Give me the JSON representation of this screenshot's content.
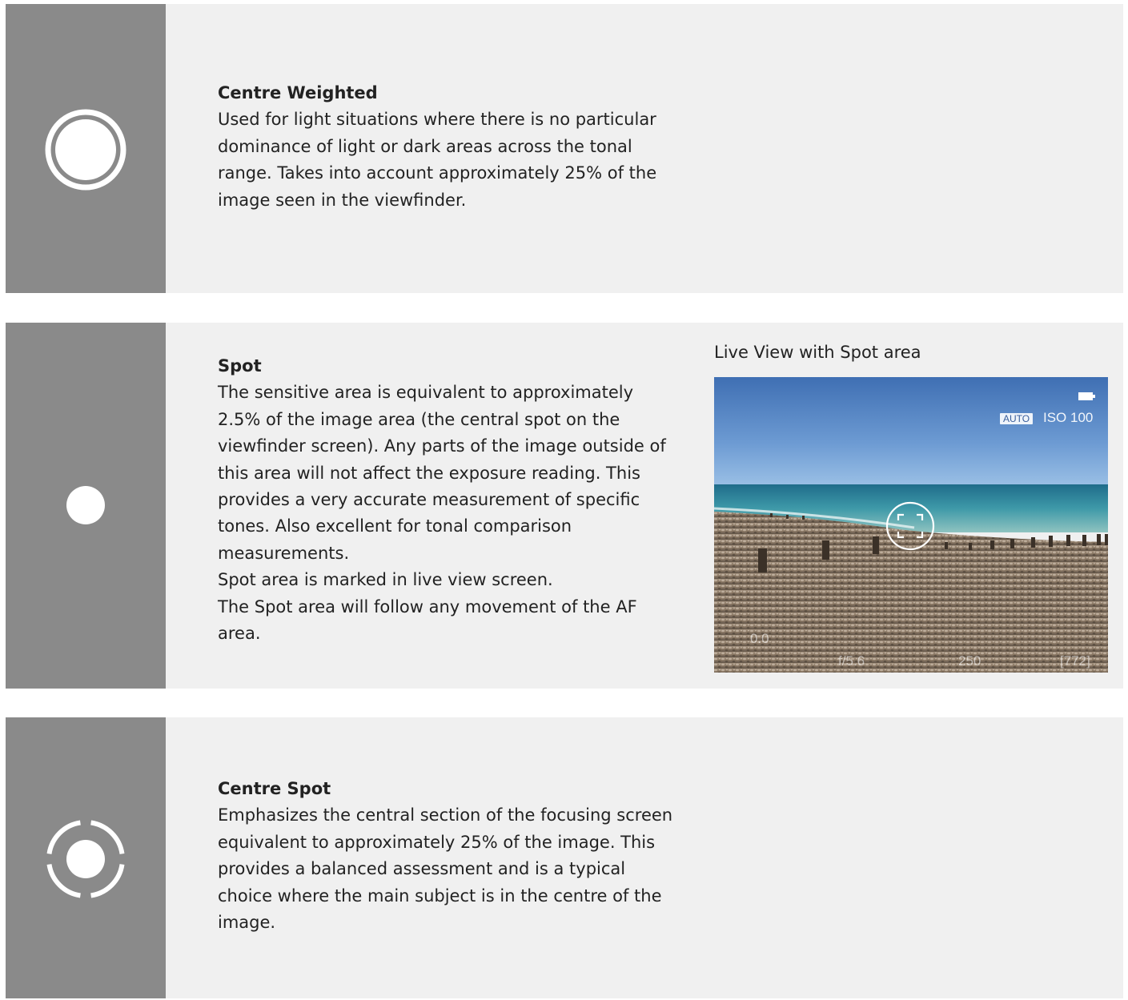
{
  "sections": [
    {
      "icon": "centre-weighted-icon",
      "title": "Centre Weighted",
      "body": "Used for light situations where there is no particular dominance of light or dark areas across the tonal range. Takes into account approximately 25% of the image seen in the viewfinder."
    },
    {
      "icon": "spot-icon",
      "title": "Spot",
      "body_lines": [
        "The sensitive area is equivalent to approximately 2.5% of the image area (the central spot on the viewfinder screen). Any parts of the image outside of this area will not affect the exposure reading. This provides a very accurate measurement of specific tones. Also excellent for tonal comparison measurements.",
        "Spot area is marked in live view screen.",
        "The Spot area will follow any movement of the AF area."
      ],
      "figure": {
        "caption": "Live View with Spot area",
        "hud": {
          "auto_badge": "AUTO",
          "iso": "ISO 100",
          "exposure_comp": "0.0",
          "aperture": "f/5.6",
          "shutter": "250",
          "shots_remaining": "[772]"
        }
      }
    },
    {
      "icon": "centre-spot-icon",
      "title": "Centre Spot",
      "body": "Emphasizes the central section of the focusing screen equivalent to approximately 25% of the image. This provides a balanced assessment and is a typical choice where the main subject is in the centre of the image."
    }
  ],
  "colors": {
    "page_background": "#ffffff",
    "panel_background": "#f0f0f0",
    "icon_band": "#8a8a8a",
    "icon_white": "#ffffff",
    "text": "#222222"
  }
}
